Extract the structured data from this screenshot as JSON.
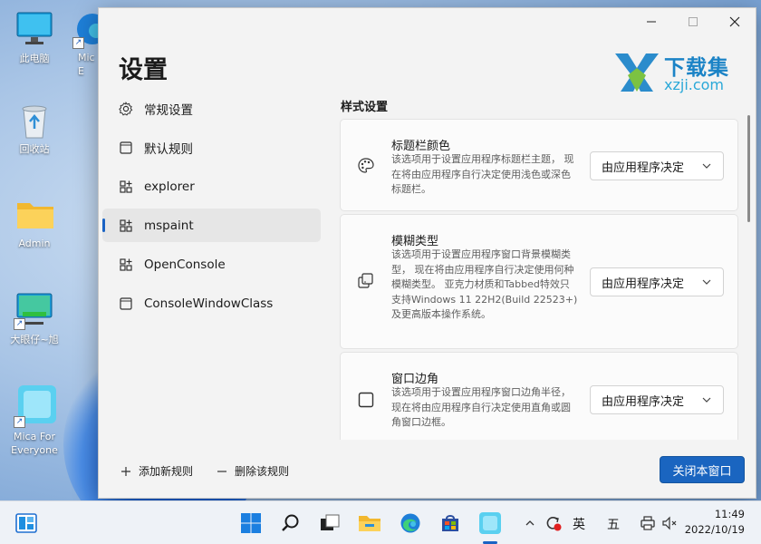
{
  "desktop": {
    "icons": [
      {
        "label": "此电脑",
        "icon": "monitor-icon"
      },
      {
        "label": "回收站",
        "icon": "recycle-bin-icon"
      },
      {
        "label": "Admin",
        "icon": "folder-icon"
      },
      {
        "label": "大眼仔~旭",
        "icon": "monitor-shortcut-icon"
      },
      {
        "label": "Mica For Everyone",
        "icon": "mica-app-icon"
      },
      {
        "label": "Mic\nE",
        "icon": "edge-shortcut-icon"
      }
    ]
  },
  "window": {
    "title": "设置",
    "controls": {
      "minimize": "minimize-icon",
      "maximize": "maximize-icon",
      "close": "close-icon"
    },
    "watermark": {
      "top": "下载集",
      "bottom": "xzji.com"
    },
    "sidebar": {
      "items": [
        {
          "label": "常规设置",
          "icon": "gear-icon",
          "selected": false
        },
        {
          "label": "默认规则",
          "icon": "window-icon",
          "selected": false
        },
        {
          "label": "explorer",
          "icon": "app-icon",
          "selected": false
        },
        {
          "label": "mspaint",
          "icon": "app-icon",
          "selected": true
        },
        {
          "label": "OpenConsole",
          "icon": "app-icon",
          "selected": false
        },
        {
          "label": "ConsoleWindowClass",
          "icon": "window-icon",
          "selected": false
        }
      ]
    },
    "bottom": {
      "add_rule": "添加新规则",
      "delete_rule": "删除该规则",
      "close_window": "关闭本窗口"
    },
    "content": {
      "section_title": "样式设置",
      "cards": [
        {
          "title": "标题栏颜色",
          "icon": "palette-icon",
          "desc": "该选项用于设置应用程序标题栏主题， 现在将由应用程序自行决定使用浅色或深色标题栏。",
          "dropdown": "由应用程序决定"
        },
        {
          "title": "模糊类型",
          "icon": "blur-layers-icon",
          "desc": "该选项用于设置应用程序窗口背景模糊类型， 现在将由应用程序自行决定使用何种模糊类型。 亚克力材质和Tabbed特效只支持Windows 11 22H2(Build 22523+)及更高版本操作系统。",
          "dropdown": "由应用程序决定"
        },
        {
          "title": "窗口边角",
          "icon": "corner-square-icon",
          "desc": "该选项用于设置应用程序窗口边角半径， 现在将由应用程序自行决定使用直角或圆角窗口边框。",
          "dropdown": "由应用程序决定"
        }
      ]
    }
  },
  "taskbar": {
    "ime_lang": "英",
    "ime_mode": "五",
    "time": "11:49",
    "date": "2022/10/19",
    "accent": "#1a63c4"
  }
}
